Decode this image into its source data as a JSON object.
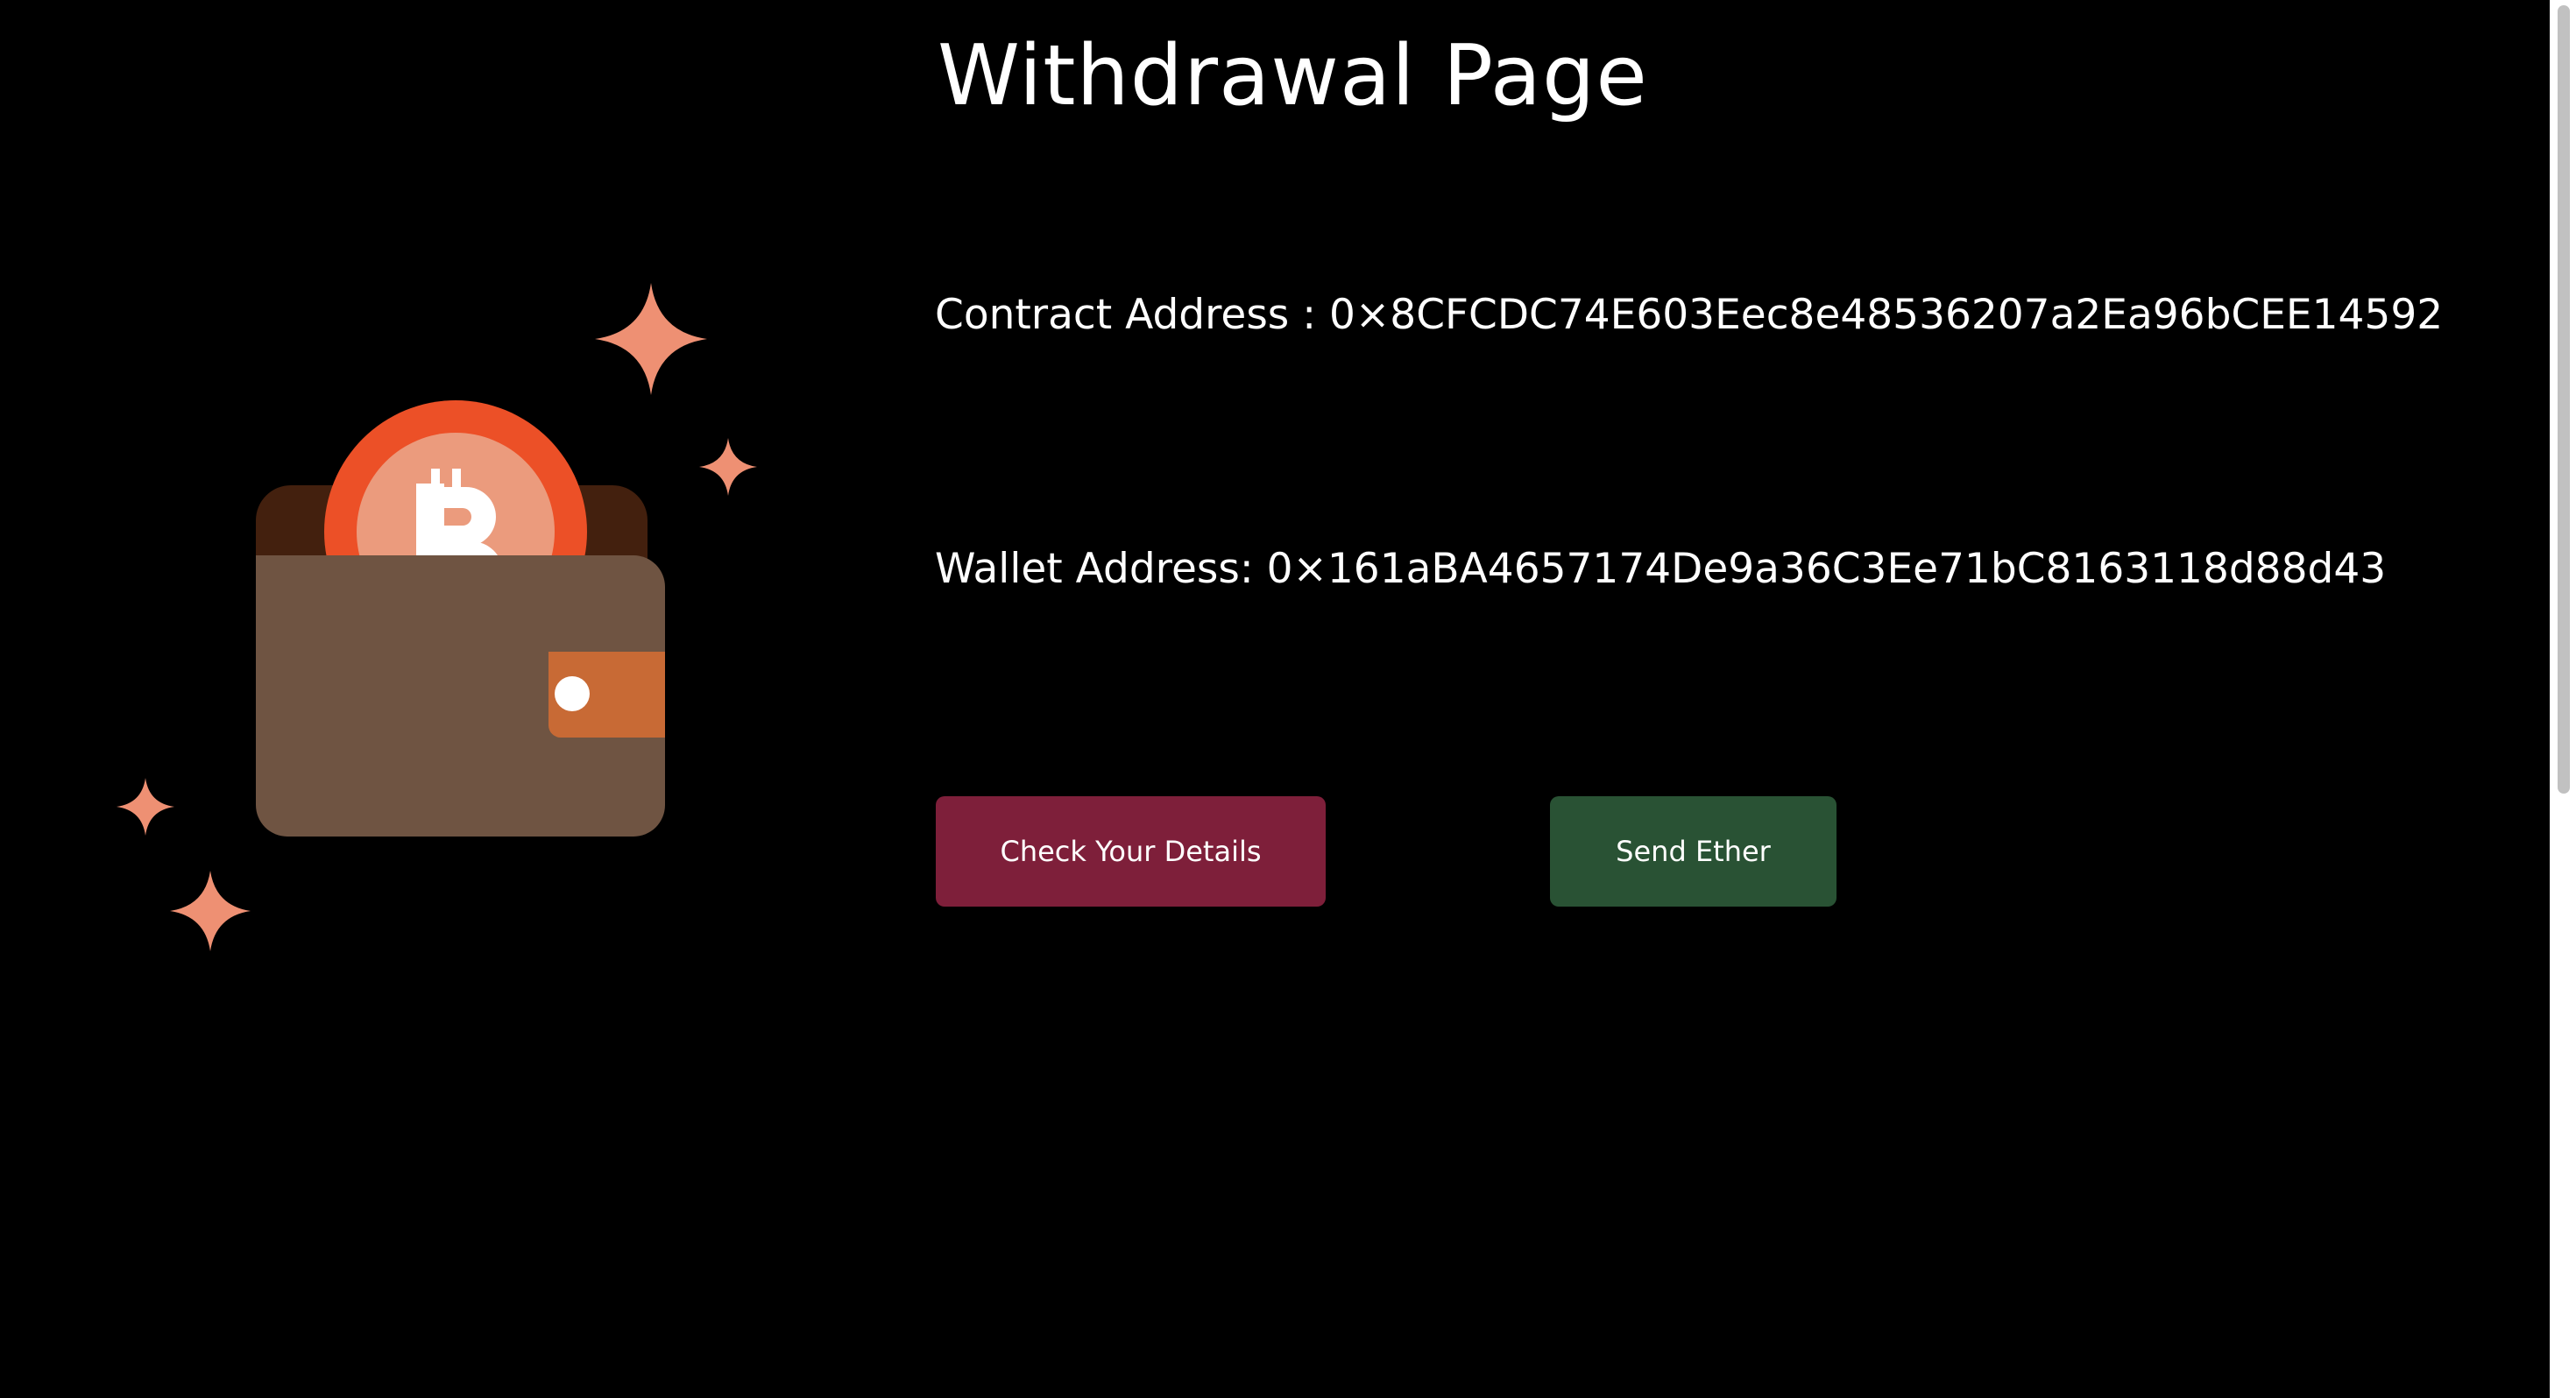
{
  "header": {
    "title": "Withdrawal Page"
  },
  "details": {
    "contract_address_text": "Contract Address : 0×8CFCDC74E603Eec8e48536207a2Ea96bCEE14592",
    "wallet_address_text": "Wallet Address: 0×161aBA4657174De9a36C3Ee71bC8163118d88d43"
  },
  "actions": {
    "check_details_label": "Check Your Details",
    "send_ether_label": "Send Ether"
  },
  "illustration": {
    "icon": "bitcoin-wallet-icon",
    "coin_symbol_icon": "bitcoin-symbol-icon",
    "sparkle_icon": "sparkle-icon"
  },
  "colors": {
    "background": "#000000",
    "text": "#ffffff",
    "check_details_button": "#7e1f3a",
    "send_ether_button": "#295234",
    "wallet_body": "#6f5442",
    "wallet_back": "#43200e",
    "wallet_clasp": "#c86a35",
    "coin_outer": "#ec5027",
    "coin_inner": "#eb9b7d",
    "sparkle": "#ee9073"
  }
}
